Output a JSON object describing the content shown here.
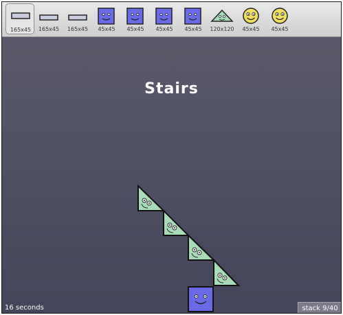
{
  "palette": {
    "items": [
      {
        "shape": "plank",
        "label": "165x45",
        "selected": true
      },
      {
        "shape": "plank",
        "label": "165x45",
        "selected": false
      },
      {
        "shape": "plank",
        "label": "165x45",
        "selected": false
      },
      {
        "shape": "blue-square",
        "label": "45x45",
        "selected": false
      },
      {
        "shape": "blue-square",
        "label": "45x45",
        "selected": false
      },
      {
        "shape": "blue-square",
        "label": "45x45",
        "selected": false
      },
      {
        "shape": "blue-square",
        "label": "45x45",
        "selected": false
      },
      {
        "shape": "green-triangle",
        "label": "120x120",
        "selected": false
      },
      {
        "shape": "yellow-smiley",
        "label": "45x45",
        "selected": false
      },
      {
        "shape": "yellow-smiley",
        "label": "45x45",
        "selected": false
      }
    ]
  },
  "level": {
    "title": "Stairs"
  },
  "status": {
    "timer": "16 seconds",
    "stack": "stack 9/40"
  },
  "colors": {
    "background_top": "#5b5b6b",
    "background_bottom": "#44445a",
    "blue_block": "#6a6ae8",
    "green_triangle": "#a8dcb8",
    "yellow_smiley": "#f1df5f",
    "plank": "#c9cbdf"
  }
}
